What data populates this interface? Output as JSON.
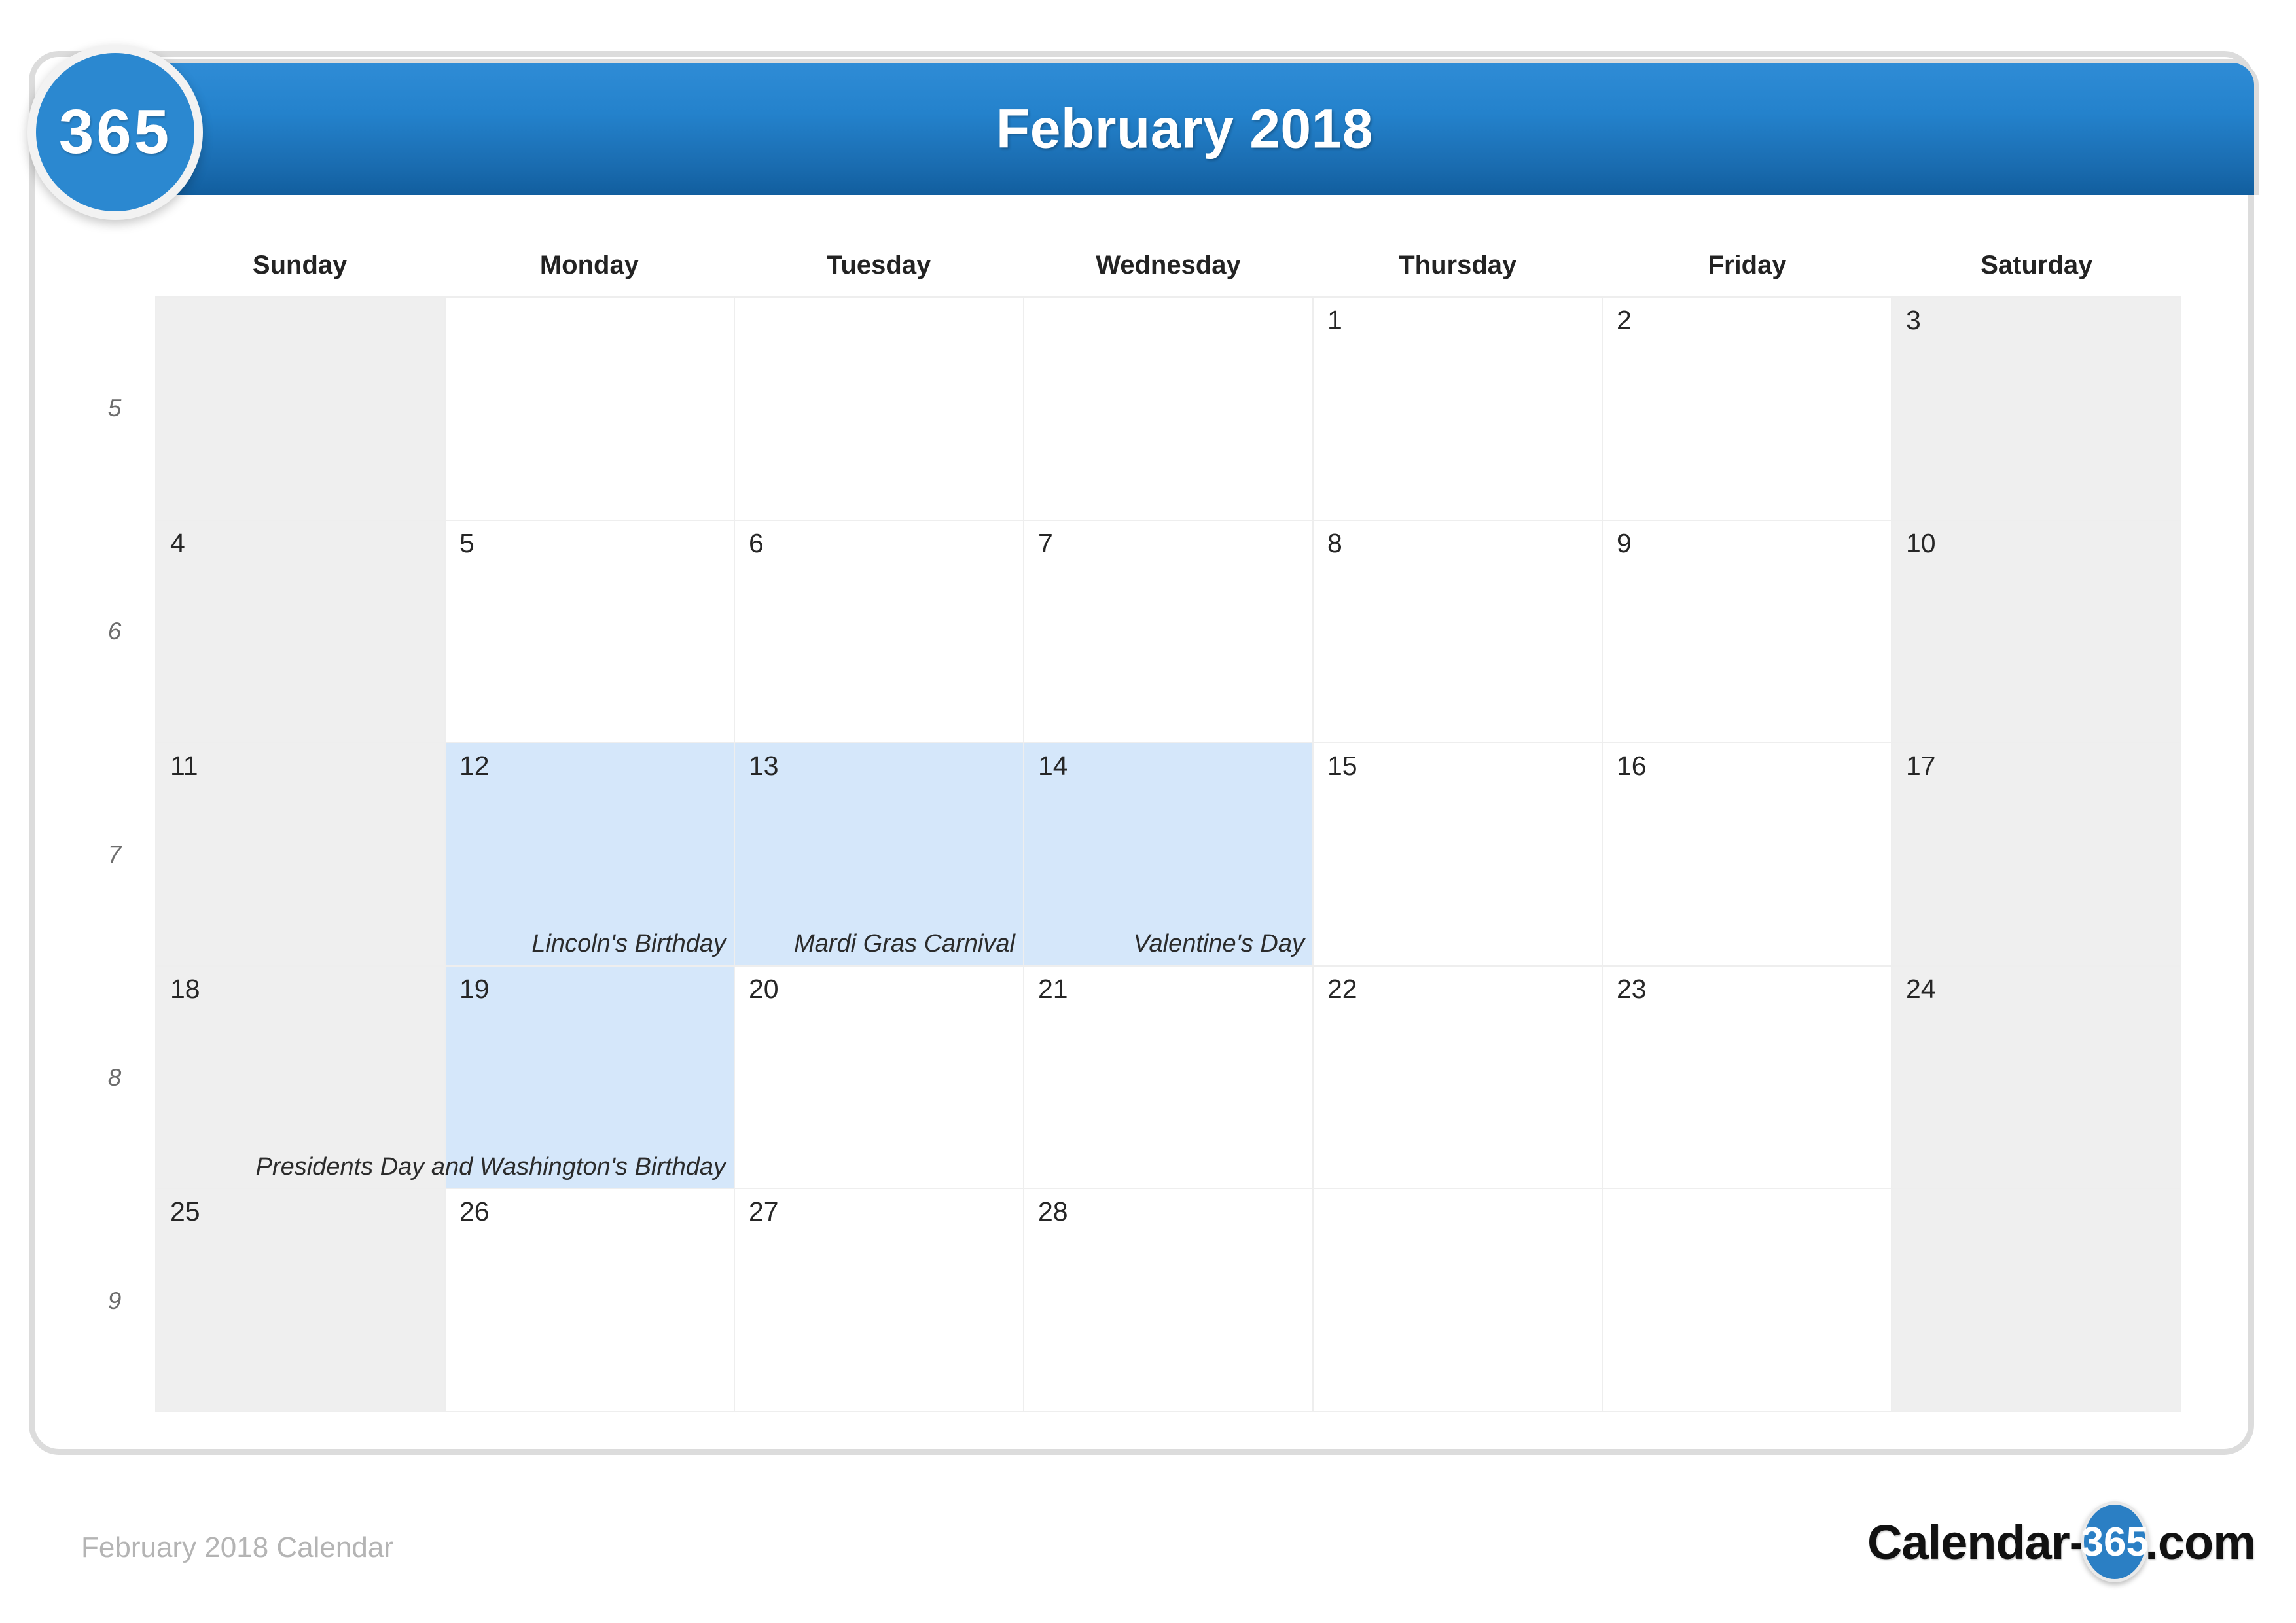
{
  "brand": {
    "badge_text": "365",
    "watermark_text": "365"
  },
  "header": {
    "title": "February 2018"
  },
  "weekdays": [
    "Sunday",
    "Monday",
    "Tuesday",
    "Wednesday",
    "Thursday",
    "Friday",
    "Saturday"
  ],
  "week_numbers": [
    "5",
    "6",
    "7",
    "8",
    "9"
  ],
  "colors": {
    "header_blue_top": "#2f8cd6",
    "header_blue_bottom": "#115e9e",
    "badge_blue": "#2b88d0",
    "weekend_gray": "#efefef",
    "event_highlight": "#d5e7fa",
    "grid_line": "#eeeeee",
    "card_border": "#dcdcdc",
    "footer_text": "#b4b4b4"
  },
  "weeks": [
    {
      "week": "5",
      "days": [
        {
          "num": "",
          "event": "",
          "blank": true,
          "weekend": true
        },
        {
          "num": "",
          "event": "",
          "blank": true,
          "weekend": false
        },
        {
          "num": "",
          "event": "",
          "blank": true,
          "weekend": false
        },
        {
          "num": "",
          "event": "",
          "blank": true,
          "weekend": false
        },
        {
          "num": "1",
          "event": "",
          "blank": false,
          "weekend": false
        },
        {
          "num": "2",
          "event": "",
          "blank": false,
          "weekend": false
        },
        {
          "num": "3",
          "event": "",
          "blank": false,
          "weekend": true
        }
      ]
    },
    {
      "week": "6",
      "days": [
        {
          "num": "4",
          "event": "",
          "blank": false,
          "weekend": true
        },
        {
          "num": "5",
          "event": "",
          "blank": false,
          "weekend": false
        },
        {
          "num": "6",
          "event": "",
          "blank": false,
          "weekend": false
        },
        {
          "num": "7",
          "event": "",
          "blank": false,
          "weekend": false
        },
        {
          "num": "8",
          "event": "",
          "blank": false,
          "weekend": false
        },
        {
          "num": "9",
          "event": "",
          "blank": false,
          "weekend": false
        },
        {
          "num": "10",
          "event": "",
          "blank": false,
          "weekend": true
        }
      ]
    },
    {
      "week": "7",
      "days": [
        {
          "num": "11",
          "event": "",
          "blank": false,
          "weekend": true
        },
        {
          "num": "12",
          "event": "Lincoln's Birthday",
          "blank": false,
          "weekend": false,
          "highlight": true
        },
        {
          "num": "13",
          "event": "Mardi Gras Carnival",
          "blank": false,
          "weekend": false,
          "highlight": true
        },
        {
          "num": "14",
          "event": "Valentine's Day",
          "blank": false,
          "weekend": false,
          "highlight": true
        },
        {
          "num": "15",
          "event": "",
          "blank": false,
          "weekend": false
        },
        {
          "num": "16",
          "event": "",
          "blank": false,
          "weekend": false
        },
        {
          "num": "17",
          "event": "",
          "blank": false,
          "weekend": true
        }
      ]
    },
    {
      "week": "8",
      "days": [
        {
          "num": "18",
          "event": "",
          "blank": false,
          "weekend": true
        },
        {
          "num": "19",
          "event": "Presidents Day and Washington's Birthday",
          "blank": false,
          "weekend": false,
          "highlight": true
        },
        {
          "num": "20",
          "event": "",
          "blank": false,
          "weekend": false
        },
        {
          "num": "21",
          "event": "",
          "blank": false,
          "weekend": false
        },
        {
          "num": "22",
          "event": "",
          "blank": false,
          "weekend": false
        },
        {
          "num": "23",
          "event": "",
          "blank": false,
          "weekend": false
        },
        {
          "num": "24",
          "event": "",
          "blank": false,
          "weekend": true
        }
      ]
    },
    {
      "week": "9",
      "days": [
        {
          "num": "25",
          "event": "",
          "blank": false,
          "weekend": true
        },
        {
          "num": "26",
          "event": "",
          "blank": false,
          "weekend": false
        },
        {
          "num": "27",
          "event": "",
          "blank": false,
          "weekend": false
        },
        {
          "num": "28",
          "event": "",
          "blank": false,
          "weekend": false
        },
        {
          "num": "",
          "event": "",
          "blank": true,
          "weekend": false
        },
        {
          "num": "",
          "event": "",
          "blank": true,
          "weekend": false
        },
        {
          "num": "",
          "event": "",
          "blank": true,
          "weekend": true
        }
      ]
    }
  ],
  "footer": {
    "label": "February 2018 Calendar",
    "logo_prefix": "Calendar-",
    "logo_circle": "365",
    "logo_suffix": ".com"
  }
}
